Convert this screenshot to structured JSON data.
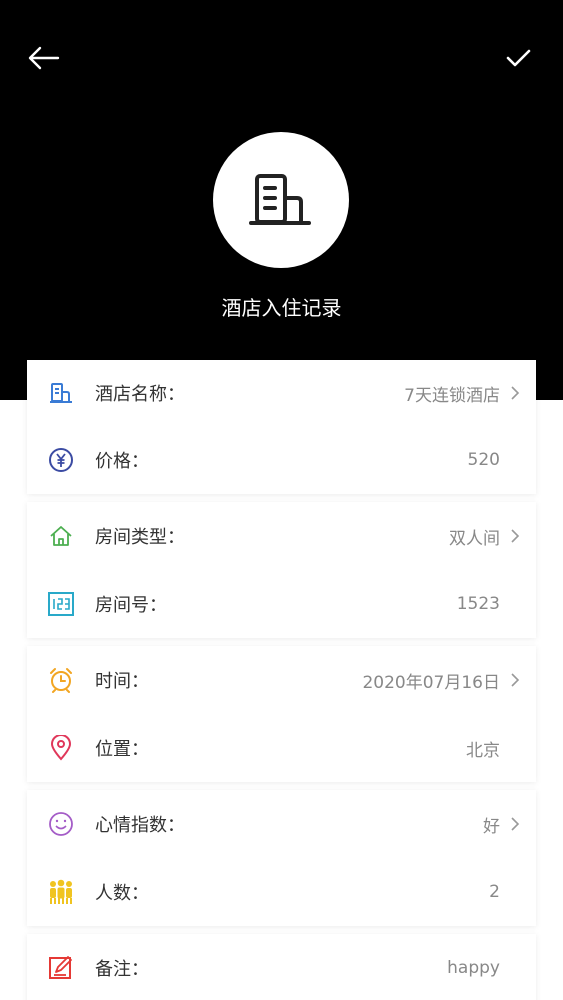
{
  "header": {
    "title": "酒店入住记录",
    "back_icon": "arrow-left-icon",
    "confirm_icon": "check-icon",
    "avatar_icon": "building-icon"
  },
  "rows": [
    {
      "label": "酒店名称：",
      "value": "7天连锁酒店",
      "icon": "hotel-icon",
      "color": "#3a7bd5",
      "chevron": true
    },
    {
      "label": "价格：",
      "value": "520",
      "icon": "yen-icon",
      "color": "#3b4ba3",
      "chevron": false
    },
    {
      "label": "房间类型：",
      "value": "双人间",
      "icon": "home-icon",
      "color": "#4caf50",
      "chevron": true
    },
    {
      "label": "房间号：",
      "value": "1523",
      "icon": "number-123-icon",
      "color": "#29a9c9",
      "chevron": false
    },
    {
      "label": "时间：",
      "value": "2020年07月16日",
      "icon": "alarm-clock-icon",
      "color": "#f2a623",
      "chevron": true
    },
    {
      "label": "位置：",
      "value": "北京",
      "icon": "location-pin-icon",
      "color": "#e0375a",
      "chevron": false
    },
    {
      "label": "心情指数：",
      "value": "好",
      "icon": "smiley-icon",
      "color": "#a45cc7",
      "chevron": true
    },
    {
      "label": "人数：",
      "value": "2",
      "icon": "people-icon",
      "color": "#f0c420",
      "chevron": false
    },
    {
      "label": "备注：",
      "value": "happy",
      "icon": "note-edit-icon",
      "color": "#e53935",
      "chevron": false
    }
  ]
}
